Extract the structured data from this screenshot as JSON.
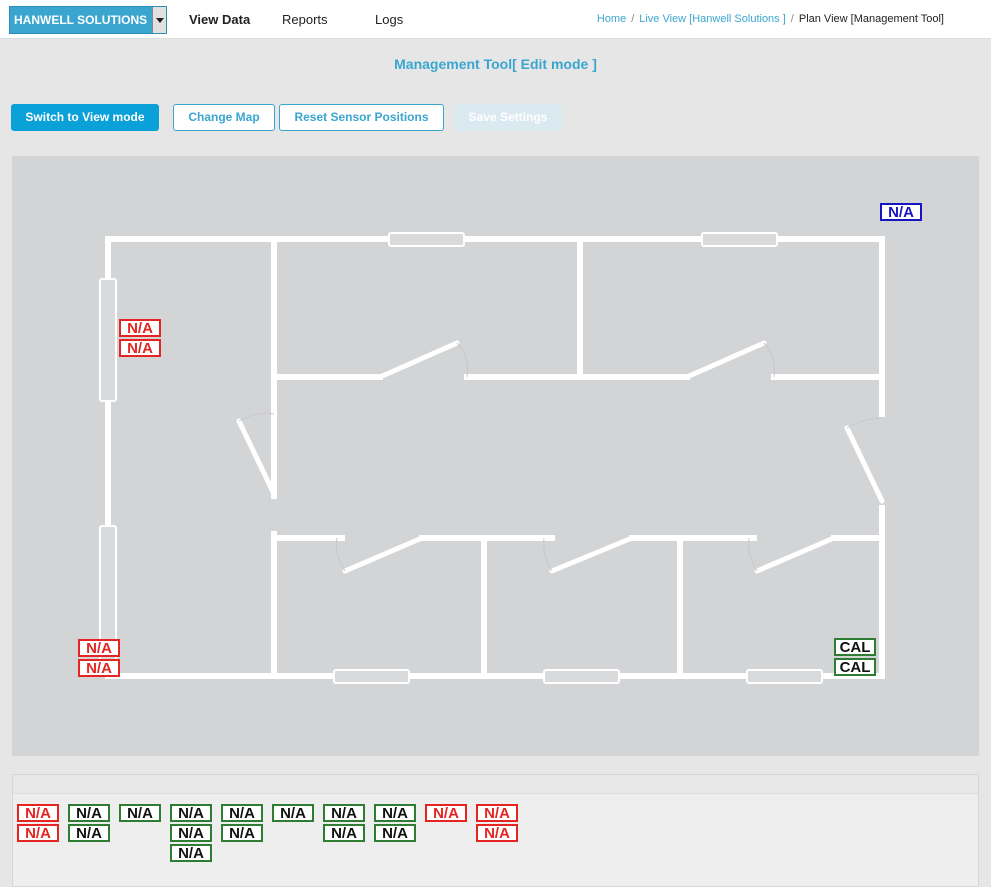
{
  "header": {
    "org_name": "HANWELL SOLUTIONS",
    "nav": [
      "View Data",
      "Reports",
      "Logs"
    ],
    "breadcrumb": [
      "Home",
      "Live View [Hanwell Solutions ]",
      "Plan View [Management Tool]"
    ]
  },
  "page_title": "Management Tool[ Edit mode ]",
  "toolbar": {
    "switch_label": "Switch to View mode",
    "change_map_label": "Change Map",
    "reset_label": "Reset Sensor Positions",
    "save_label": "Save Settings"
  },
  "colors": {
    "accent": "#3aa6d0",
    "status_red": "#e52521",
    "status_green": "#2e7d32",
    "status_blue": "#1515c2"
  },
  "map_sensors": [
    {
      "status": "red",
      "readings": [
        "N/A",
        "N/A"
      ]
    },
    {
      "status": "blue",
      "readings": [
        "N/A"
      ]
    },
    {
      "status": "red",
      "readings": [
        "N/A",
        "N/A"
      ]
    },
    {
      "status": "green",
      "readings": [
        "CAL",
        "CAL"
      ]
    }
  ],
  "tray_sensors": [
    {
      "status": "red",
      "readings": [
        "N/A",
        "N/A"
      ]
    },
    {
      "status": "green",
      "readings": [
        "N/A",
        "N/A"
      ]
    },
    {
      "status": "green",
      "readings": [
        "N/A"
      ]
    },
    {
      "status": "green",
      "readings": [
        "N/A",
        "N/A",
        "N/A"
      ]
    },
    {
      "status": "green",
      "readings": [
        "N/A",
        "N/A"
      ]
    },
    {
      "status": "green",
      "readings": [
        "N/A"
      ]
    },
    {
      "status": "green",
      "readings": [
        "N/A",
        "N/A"
      ]
    },
    {
      "status": "green",
      "readings": [
        "N/A",
        "N/A"
      ]
    },
    {
      "status": "red",
      "readings": [
        "N/A"
      ]
    },
    {
      "status": "red",
      "readings": [
        "N/A",
        "N/A"
      ]
    }
  ]
}
